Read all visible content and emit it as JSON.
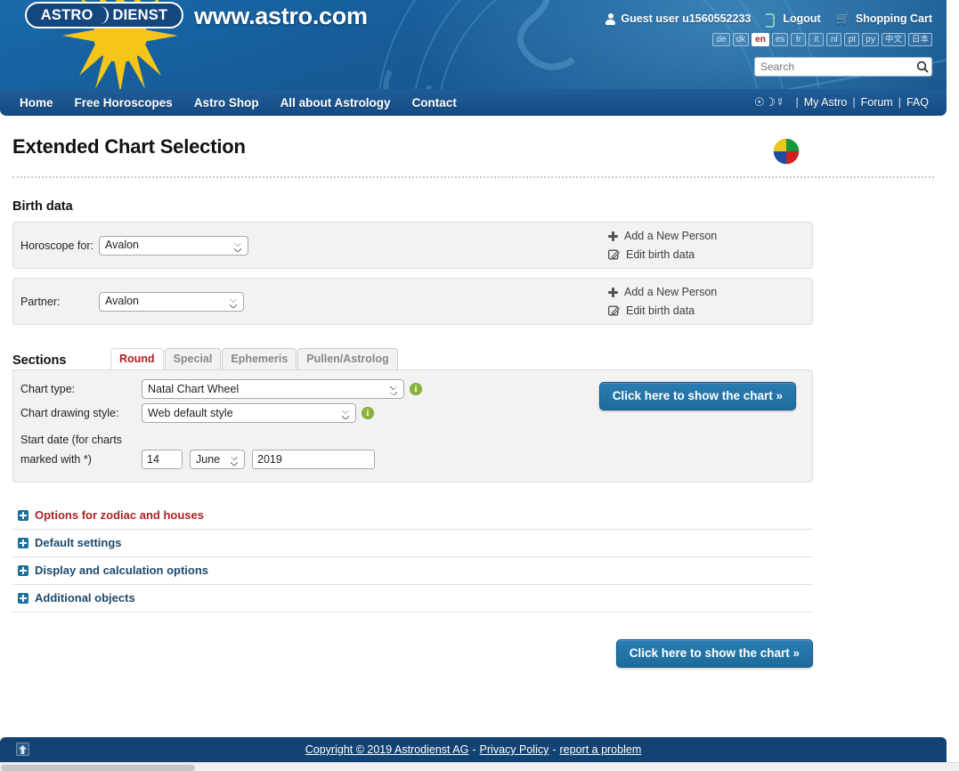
{
  "header": {
    "logo_text_a": "ASTRO",
    "logo_text_b": "DIENST",
    "brand_url": "www.astro.com",
    "user": {
      "guest_label": "Guest user u1560552233",
      "logout_label": "Logout",
      "cart_label": "Shopping Cart",
      "person_icon": "person-icon",
      "logout_icon": "logout-icon",
      "cart_icon": "cart-icon"
    },
    "languages": [
      {
        "code": "de",
        "active": false
      },
      {
        "code": "dk",
        "active": false
      },
      {
        "code": "en",
        "active": true
      },
      {
        "code": "es",
        "active": false
      },
      {
        "code": "fr",
        "active": false
      },
      {
        "code": "it",
        "active": false
      },
      {
        "code": "nl",
        "active": false
      },
      {
        "code": "pt",
        "active": false
      },
      {
        "code": "py",
        "active": false
      },
      {
        "code": "中文",
        "active": false
      },
      {
        "code": "日本",
        "active": false
      }
    ],
    "search": {
      "placeholder": "Search",
      "value": "",
      "icon": "search-icon"
    }
  },
  "nav": {
    "items": [
      {
        "label": "Home"
      },
      {
        "label": "Free Horoscopes"
      },
      {
        "label": "Astro Shop"
      },
      {
        "label": "All about Astrology"
      },
      {
        "label": "Contact"
      }
    ],
    "right": {
      "planet_glyphs": "☉☽☿",
      "my_astro": "My Astro",
      "forum": "Forum",
      "faq": "FAQ",
      "separator": "|"
    }
  },
  "main": {
    "page_title": "Extended Chart Selection",
    "logo_circle_icon": "astrodienst-quadrant-logo-icon",
    "birth_data": {
      "heading": "Birth data",
      "rows": [
        {
          "label": "Horoscope for:",
          "select_value": "Avalon",
          "add_person_label": "Add a New Person",
          "edit_label": "Edit birth data"
        },
        {
          "label": "Partner:",
          "select_value": "Avalon",
          "add_person_label": "Add a New Person",
          "edit_label": "Edit birth data"
        }
      ]
    },
    "sections": {
      "heading": "Sections",
      "tabs": [
        {
          "label": "Round",
          "active": true
        },
        {
          "label": "Special",
          "active": false
        },
        {
          "label": "Ephemeris",
          "active": false
        },
        {
          "label": "Pullen/Astrolog",
          "active": false
        }
      ],
      "chart_type_label": "Chart type:",
      "chart_type_value": "Natal Chart Wheel",
      "drawing_style_label": "Chart drawing style:",
      "drawing_style_value": "Web default style",
      "start_date_label_line1": "Start date (for charts",
      "start_date_label_line2": "marked with *)",
      "date_day": "14",
      "date_month": "June",
      "date_year": "2019",
      "info_icon": "info-icon",
      "show_chart_button": "Click here to show the chart »"
    },
    "accordion": [
      {
        "label": "Options for zodiac and houses",
        "highlight": true
      },
      {
        "label": "Default settings",
        "highlight": false
      },
      {
        "label": "Display and calculation options",
        "highlight": false
      },
      {
        "label": "Additional objects",
        "highlight": false
      }
    ],
    "show_chart_button_bottom": "Click here to show the chart »"
  },
  "footer": {
    "back_to_top_icon": "arrow-up-icon",
    "copyright": "Copyright © 2019 Astrodienst AG",
    "sep1": "-",
    "privacy": "Privacy Policy",
    "sep2": "-",
    "report": "report a problem"
  },
  "colors": {
    "header_blue": "#16619f",
    "nav_blue": "#17558f",
    "footer_blue": "#134372",
    "accent_red": "#a82525",
    "accent_navy": "#1b4a6e",
    "button_blue": "#1d6c9c",
    "info_green": "#8cb43c"
  }
}
